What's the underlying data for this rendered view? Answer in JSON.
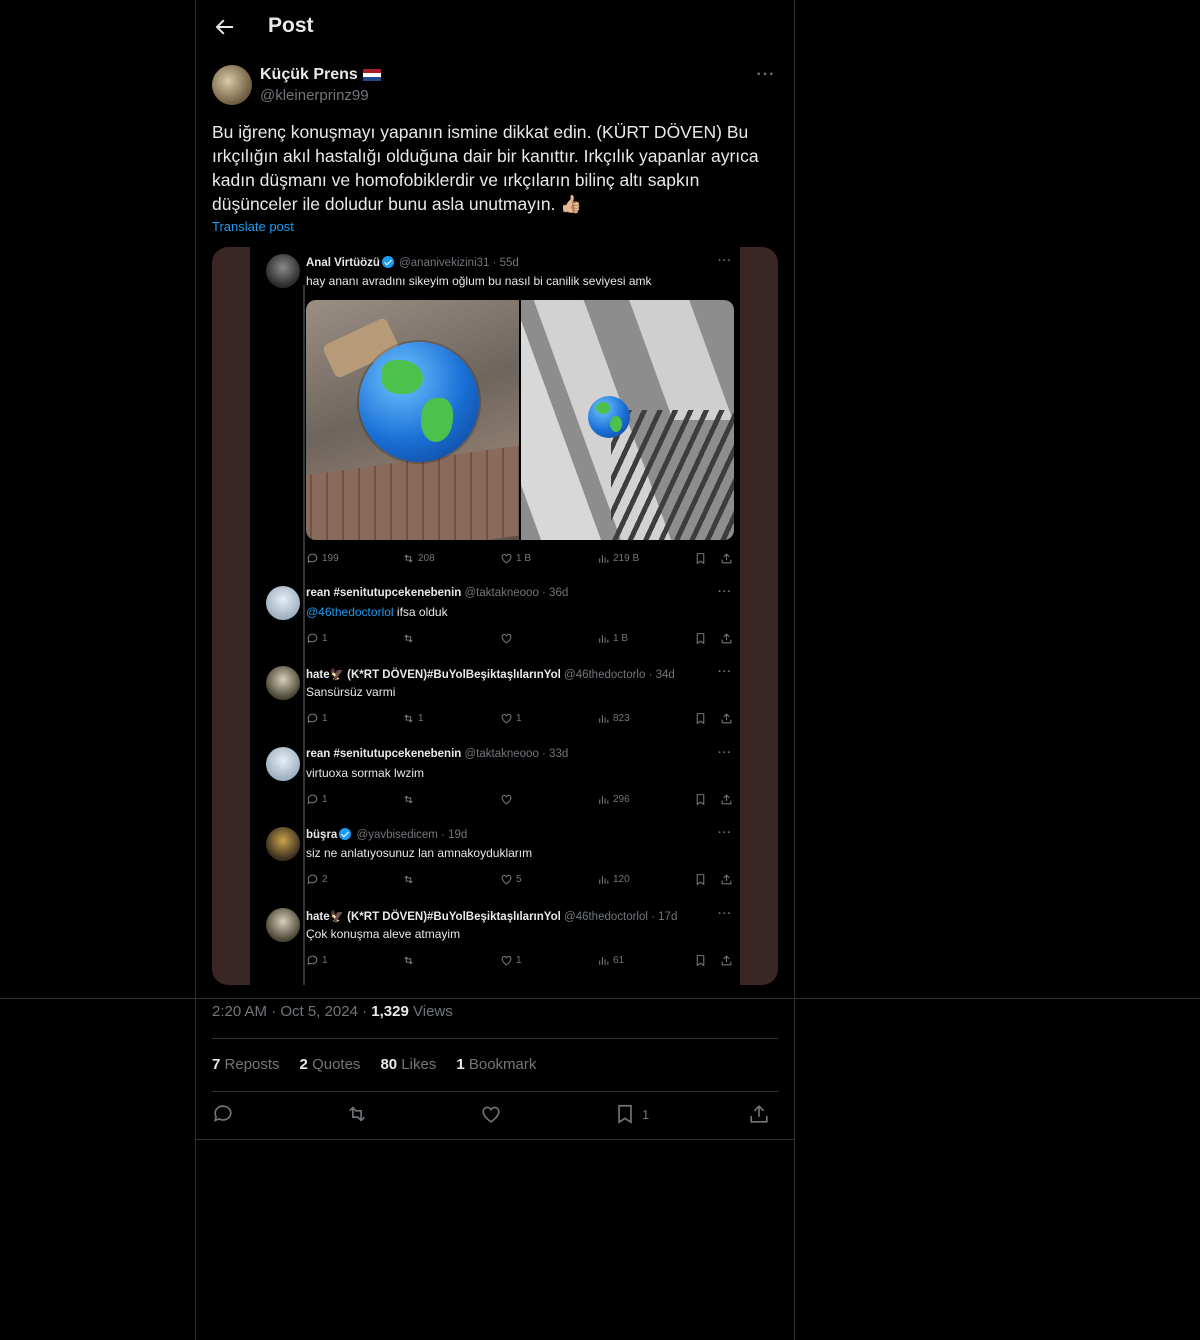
{
  "header": {
    "title": "Post"
  },
  "post": {
    "author_name": "Küçük Prens",
    "author_handle": "@kleinerprinz99",
    "flag_colors": [
      "#ae1c28",
      "#ffffff",
      "#21468b"
    ],
    "text": "Bu iğrenç konuşmayı yapanın ismine dikkat edin. (KÜRT DÖVEN) Bu ırkçılığın akıl hastalığı olduğuna dair bir kanıttır. Irkçılık yapanlar ayrıca kadın düşmanı ve homofobiklerdir ve ırkçıların bilinç altı sapkın düşünceler ile doludur bunu asla unutmayın. 👍🏼",
    "translate_label": "Translate post",
    "time": "2:20 AM",
    "date": "Oct 5, 2024",
    "views_count": "1,329",
    "views_label": "Views"
  },
  "screenshot": {
    "main": {
      "name": "Anal Virtüözü",
      "handle_time": "@ananivekizini31 · 55d",
      "text": "hay ananı avradını sikeyim oğlum bu nasıl bi canilik seviyesi amk",
      "replies": "199",
      "reposts": "208",
      "likes": "1 B",
      "views": "219 B"
    },
    "replies": [
      {
        "name": "rean #senitutupcekenebenin",
        "handle_time": "@taktakneooo · 36d",
        "mention": "@46thedoctorlol",
        "text": " ifsa olduk",
        "r": "1",
        "rt": "",
        "l": "",
        "v": "1 B"
      },
      {
        "name": "hate🦅 (K*RT DÖVEN)#BuYolBeşiktaşlılarınYol",
        "handle_time": "@46thedoctorlo · 34d",
        "mention": "",
        "text": "Sansürsüz varmi",
        "r": "1",
        "rt": "1",
        "l": "1",
        "v": "823"
      },
      {
        "name": "rean #senitutupcekenebenin",
        "handle_time": "@taktakneooo · 33d",
        "mention": "",
        "text": "virtuoxa sormak lwzim",
        "r": "1",
        "rt": "",
        "l": "",
        "v": "296"
      },
      {
        "name": "büşra",
        "handle_time": "@yavbisedicem · 19d",
        "mention": "",
        "text": "siz ne anlatıyosunuz lan amnakoyduklarım",
        "r": "2",
        "rt": "",
        "l": "5",
        "v": "120"
      },
      {
        "name": "hate🦅 (K*RT DÖVEN)#BuYolBeşiktaşlılarınYol",
        "handle_time": "@46thedoctorlol · 17d",
        "mention": "",
        "text": "Çok konuşma aleve atmayim",
        "r": "1",
        "rt": "",
        "l": "1",
        "v": "61"
      }
    ]
  },
  "stats": {
    "reposts_count": "7",
    "reposts_label": "Reposts",
    "quotes_count": "2",
    "quotes_label": "Quotes",
    "likes_count": "80",
    "likes_label": "Likes",
    "bookmarks_count": "1",
    "bookmarks_label": "Bookmark"
  },
  "actions": {
    "bookmark_count": "1"
  },
  "colors": {
    "accent": "#1d9bf0",
    "muted": "#71767b",
    "text": "#e7e9ea",
    "border": "#2f3336"
  }
}
